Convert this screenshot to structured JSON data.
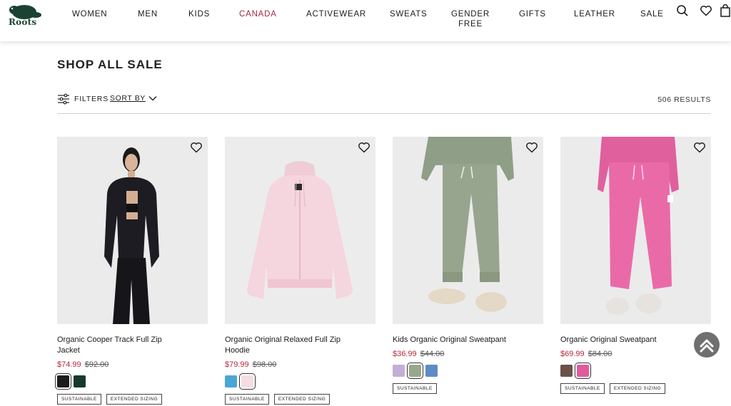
{
  "header": {
    "logo_text": "Roots",
    "nav": [
      {
        "label": "WOMEN"
      },
      {
        "label": "MEN"
      },
      {
        "label": "KIDS"
      },
      {
        "label": "CANADA"
      },
      {
        "label": "ACTIVEWEAR"
      },
      {
        "label": "SWEATS"
      },
      {
        "label": "GENDER FREE"
      },
      {
        "label": "GIFTS"
      },
      {
        "label": "LEATHER"
      },
      {
        "label": "SALE"
      }
    ],
    "icons": [
      "search-icon",
      "heart-icon",
      "bag-icon"
    ],
    "accent_color": "#a3263f"
  },
  "page": {
    "title": "SHOP ALL SALE",
    "filters_label": "FILTERS",
    "sort_label": "SORT BY",
    "results": "506 RESULTS"
  },
  "products": [
    {
      "name": "Organic Cooper Track Full Zip Jacket",
      "sale_price": "$74.99",
      "original_price": "$92.00",
      "swatches": [
        "#1d1d1d",
        "#173a2c"
      ],
      "badges": [
        "SUSTAINABLE",
        "EXTENDED SIZING"
      ]
    },
    {
      "name": "Organic Original Relaxed Full Zip Hoodie",
      "sale_price": "$79.99",
      "original_price": "$98.00",
      "swatches": [
        "#4aa6d6",
        "#f5dde2"
      ],
      "badges": [
        "SUSTAINABLE",
        "EXTENDED SIZING"
      ]
    },
    {
      "name": "Kids Organic Original Sweatpant",
      "sale_price": "$36.99",
      "original_price": "$44.00",
      "swatches": [
        "#c3aed6",
        "#99a78a",
        "#5d8cc4"
      ],
      "badges": [
        "SUSTAINABLE"
      ]
    },
    {
      "name": "Organic Original Sweatpant",
      "sale_price": "$69.99",
      "original_price": "$84.00",
      "swatches": [
        "#6b5148",
        "#e35a9b"
      ],
      "badges": [
        "SUSTAINABLE",
        "EXTENDED SIZING"
      ]
    }
  ]
}
